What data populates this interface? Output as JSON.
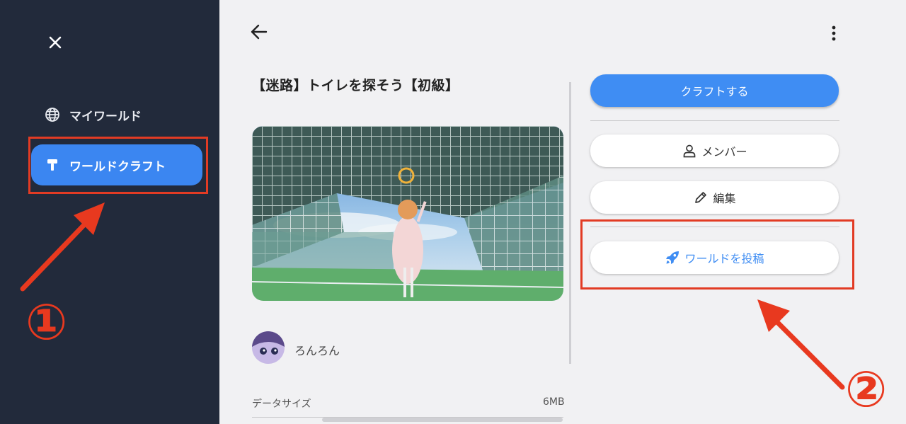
{
  "sidebar": {
    "items": [
      {
        "label": "マイワールド",
        "icon": "globe-icon",
        "active": false
      },
      {
        "label": "ワールドクラフト",
        "icon": "hammer-icon",
        "active": true
      }
    ]
  },
  "world": {
    "title": "【迷路】トイレを探そう【初級】",
    "author": "ろんろん",
    "data_size_label": "データサイズ",
    "data_size_value": "6MB"
  },
  "actions": {
    "craft_label": "クラフトする",
    "member_label": "メンバー",
    "edit_label": "編集",
    "post_label": "ワールドを投稿"
  },
  "annotations": {
    "step1": "①",
    "step2": "②"
  },
  "colors": {
    "sidebar_bg": "#222a3b",
    "accent": "#3f8df3",
    "annotation": "#e23b24"
  }
}
